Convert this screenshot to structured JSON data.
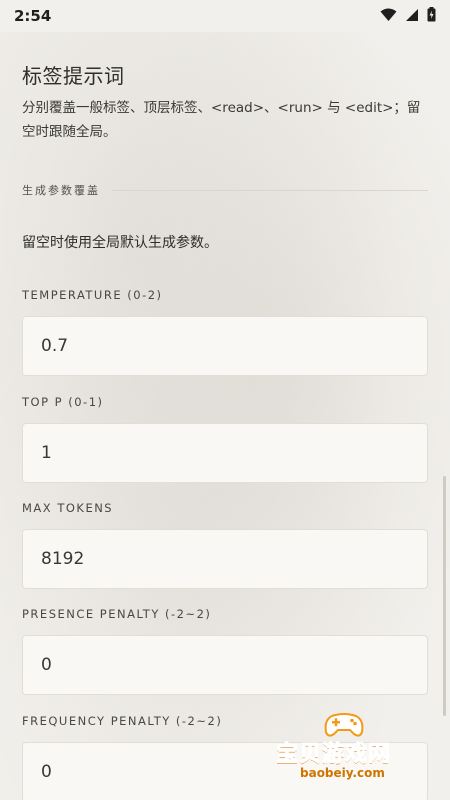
{
  "status": {
    "time": "2:54"
  },
  "sheet": {
    "title": "标签提示词",
    "subtitle": "分别覆盖一般标签、顶层标签、<read>、<run> 与 <edit>；留空时跟随全局。",
    "section_label": "生成参数覆盖",
    "note": "留空时使用全局默认生成参数。",
    "fields": [
      {
        "label": "TEMPERATURE (0-2)",
        "value": "0.7"
      },
      {
        "label": "TOP P (0-1)",
        "value": "1"
      },
      {
        "label": "MAX TOKENS",
        "value": "8192"
      },
      {
        "label": "PRESENCE PENALTY (-2~2)",
        "value": "0"
      },
      {
        "label": "FREQUENCY PENALTY (-2~2)",
        "value": "0"
      }
    ]
  },
  "watermark": {
    "name": "宝贝游戏网",
    "url": "baobeiy.com"
  },
  "colors": {
    "background": "#f3f1ee",
    "input_bg": "#faf8f4",
    "watermark_orange": "#f39a17"
  }
}
